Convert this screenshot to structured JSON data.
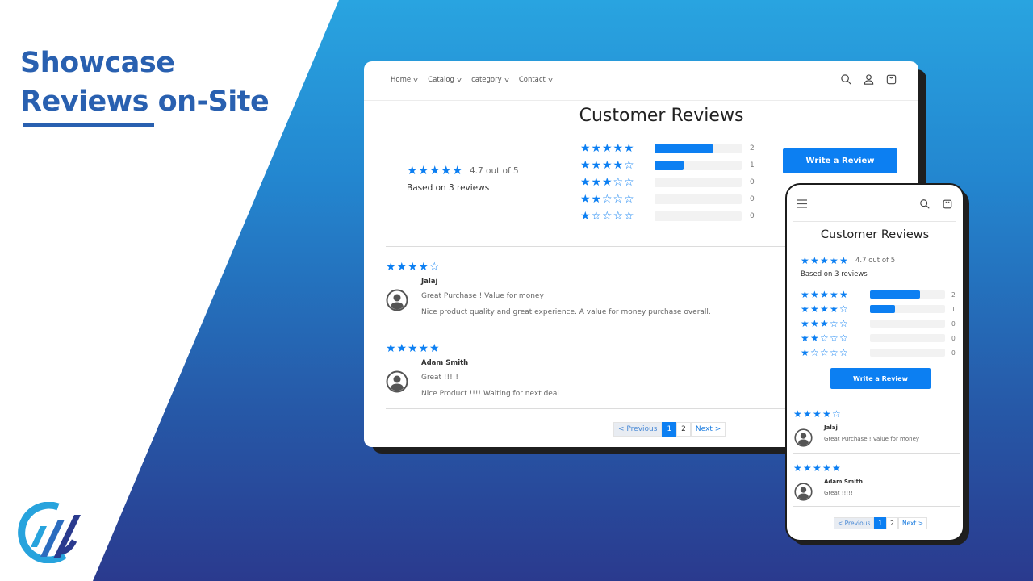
{
  "marketing": {
    "headline_line1": "Showcase",
    "headline_line2": "Reviews on-Site",
    "brand_color": "#2960b0",
    "logo_icon": "brand-logo-icon"
  },
  "desktop": {
    "nav": {
      "links": [
        {
          "label": "Home"
        },
        {
          "label": "Catalog"
        },
        {
          "label": "category"
        },
        {
          "label": "Contact"
        }
      ],
      "icons": [
        "search-icon",
        "account-icon",
        "cart-icon"
      ]
    },
    "title": "Customer Reviews",
    "summary": {
      "avg_stars": 5,
      "avg_text": "4.7 out of 5",
      "based_on": "Based on 3 reviews"
    },
    "histogram": [
      {
        "stars": 5,
        "count": "2",
        "fill": 0.67
      },
      {
        "stars": 4,
        "count": "1",
        "fill": 0.33
      },
      {
        "stars": 3,
        "count": "0",
        "fill": 0
      },
      {
        "stars": 2,
        "count": "0",
        "fill": 0
      },
      {
        "stars": 1,
        "count": "0",
        "fill": 0
      }
    ],
    "write_review_label": "Write a Review",
    "reviews": [
      {
        "stars": 4,
        "author": "Jalaj",
        "title": "Great Purchase ! Value for money",
        "body": "Nice product quality and great experience. A value for money purchase overall."
      },
      {
        "stars": 5,
        "author": "Adam Smith",
        "title": "Great !!!!!",
        "body": "Nice Product !!!! Waiting for next deal !"
      }
    ],
    "pagination": {
      "previous": "< Previous",
      "pages": [
        "1",
        "2"
      ],
      "current": "1",
      "next": "Next >"
    }
  },
  "mobile": {
    "icons": [
      "menu-icon",
      "search-icon",
      "cart-icon"
    ],
    "title": "Customer Reviews",
    "summary": {
      "avg_stars": 5,
      "avg_text": "4.7 out of 5",
      "based_on": "Based on 3 reviews"
    },
    "histogram": [
      {
        "stars": 5,
        "count": "2",
        "fill": 0.67
      },
      {
        "stars": 4,
        "count": "1",
        "fill": 0.33
      },
      {
        "stars": 3,
        "count": "0",
        "fill": 0
      },
      {
        "stars": 2,
        "count": "0",
        "fill": 0
      },
      {
        "stars": 1,
        "count": "0",
        "fill": 0
      }
    ],
    "write_review_label": "Write a Review",
    "reviews": [
      {
        "stars": 4,
        "author": "Jalaj",
        "title": "Great Purchase ! Value for money"
      },
      {
        "stars": 5,
        "author": "Adam Smith",
        "title": "Great !!!!!"
      }
    ],
    "pagination": {
      "previous": "< Previous",
      "pages": [
        "1",
        "2"
      ],
      "current": "1",
      "next": "Next >"
    }
  },
  "colors": {
    "accent": "#0c7ff2",
    "bar_track": "#f2f2f2"
  }
}
